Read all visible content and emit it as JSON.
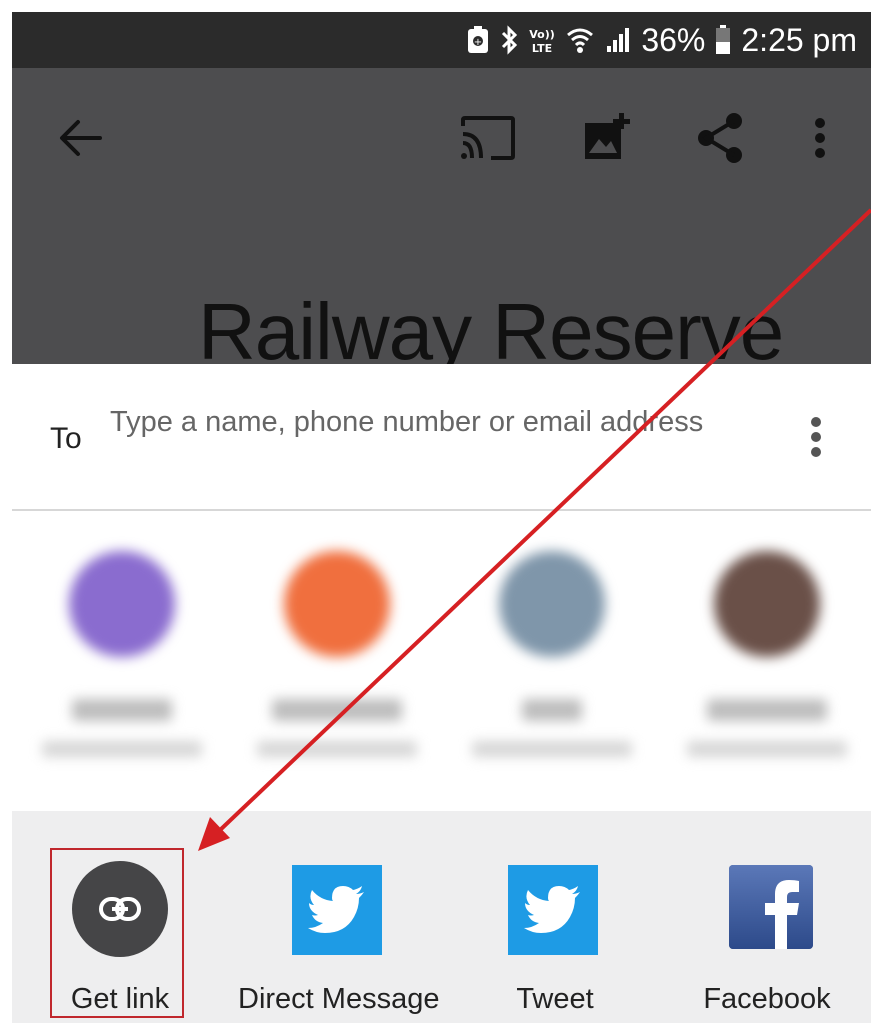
{
  "status_bar": {
    "battery_percent": "36%",
    "time": "2:25 pm",
    "volte_label": "Vo)) LTE"
  },
  "app_bar": {
    "icons": [
      "back-arrow-icon",
      "cast-icon",
      "add-photo-icon",
      "share-icon",
      "more-vert-icon"
    ],
    "document_title": "Railway Reserve"
  },
  "share_sheet": {
    "to_label": "To",
    "recipient_placeholder": "Type a name, phone number or email address",
    "contacts_blurred": [
      {
        "avatar_color": "#8a6ccf"
      },
      {
        "avatar_color": "#f06f3e"
      },
      {
        "avatar_color": "#7f96aa"
      },
      {
        "avatar_color": "#6a5048"
      }
    ],
    "targets": [
      {
        "label": "Get link",
        "icon": "link-icon"
      },
      {
        "label": "Direct Message",
        "icon": "twitter-icon"
      },
      {
        "label": "Tweet",
        "icon": "twitter-icon"
      },
      {
        "label": "Facebook",
        "icon": "facebook-icon"
      }
    ]
  },
  "colors": {
    "status_bar": "#2b2b2b",
    "app_bar": "#4d4d4f",
    "twitter_blue": "#1e9be5",
    "facebook_blue": "#3b5998",
    "annotation_red": "#d62023"
  }
}
